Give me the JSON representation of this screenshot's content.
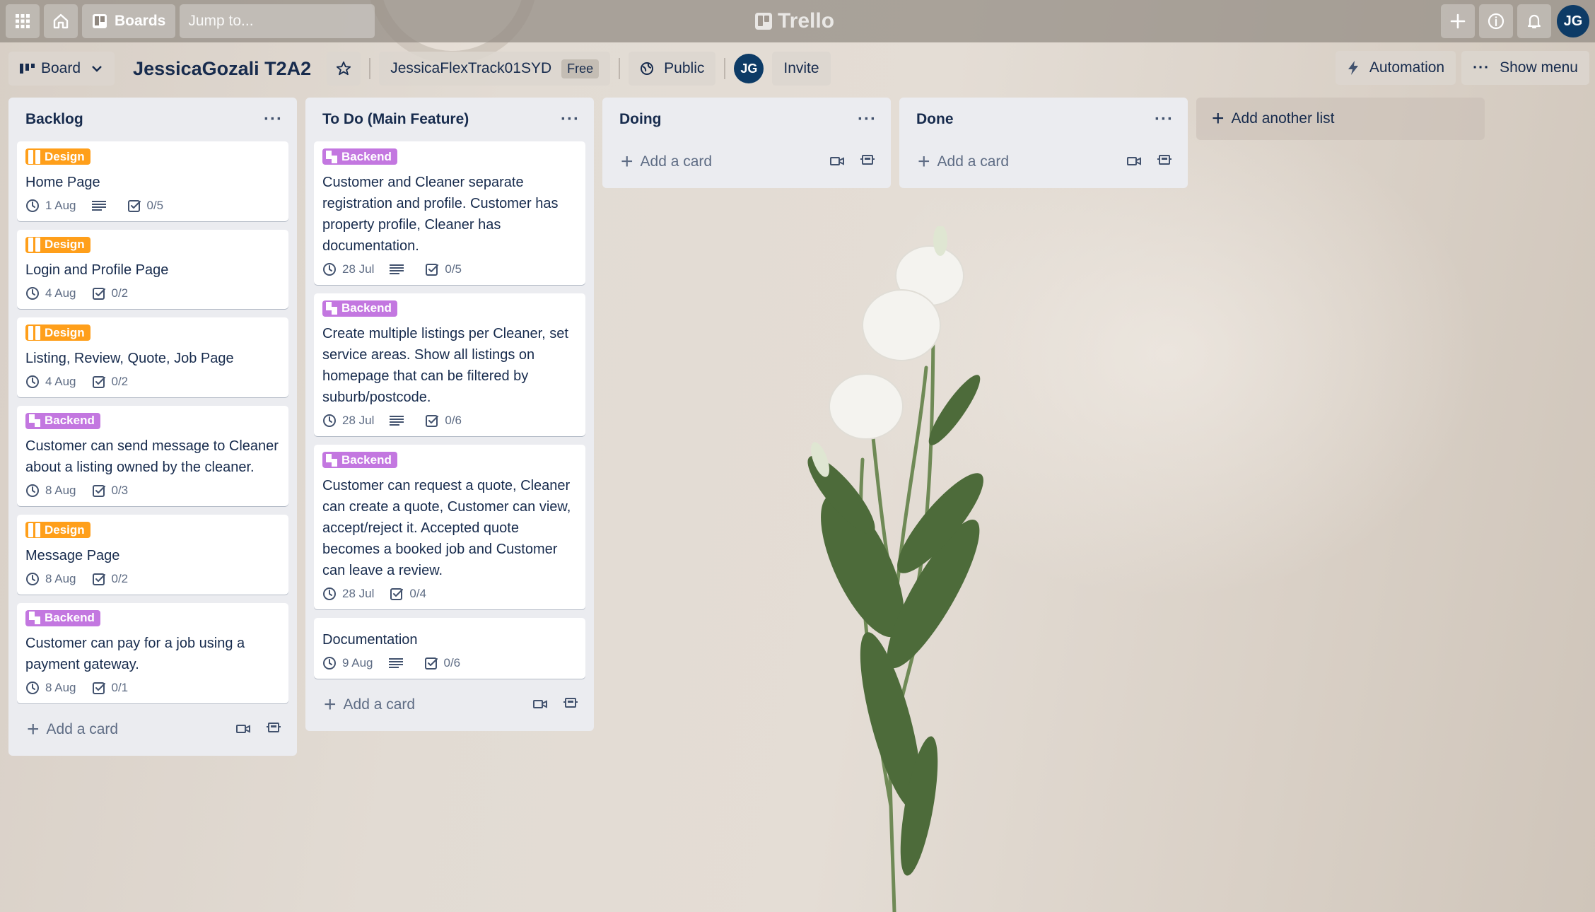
{
  "app": {
    "logo_text": "Trello",
    "boards_label": "Boards",
    "search_placeholder": "Jump to...",
    "user_initials": "JG"
  },
  "board": {
    "view_label": "Board",
    "title": "JessicaGozali T2A2",
    "workspace": "JessicaFlexTrack01SYD",
    "workspace_plan": "Free",
    "visibility": "Public",
    "invite_label": "Invite",
    "automation_label": "Automation",
    "show_menu_label": "Show menu"
  },
  "colors": {
    "design_label": "#ff9f1a",
    "backend_label": "#c377e0",
    "list_bg": "#ebecf0"
  },
  "lists": [
    {
      "title": "Backlog",
      "add_card_label": "Add a card",
      "cards": [
        {
          "label": "Design",
          "title": "Home Page",
          "due": "1 Aug",
          "has_description": true,
          "checklist": "0/5"
        },
        {
          "label": "Design",
          "title": "Login and Profile Page",
          "due": "4 Aug",
          "has_description": false,
          "checklist": "0/2"
        },
        {
          "label": "Design",
          "title": "Listing, Review, Quote, Job Page",
          "due": "4 Aug",
          "has_description": false,
          "checklist": "0/2"
        },
        {
          "label": "Backend",
          "title": "Customer can send message to Cleaner about a listing owned by the cleaner.",
          "due": "8 Aug",
          "has_description": false,
          "checklist": "0/3"
        },
        {
          "label": "Design",
          "title": "Message Page",
          "due": "8 Aug",
          "has_description": false,
          "checklist": "0/2"
        },
        {
          "label": "Backend",
          "title": "Customer can pay for a job using a payment gateway.",
          "due": "8 Aug",
          "has_description": false,
          "checklist": "0/1"
        }
      ]
    },
    {
      "title": "To Do (Main Feature)",
      "add_card_label": "Add a card",
      "cards": [
        {
          "label": "Backend",
          "title": "Customer and Cleaner separate registration and profile. Customer has property profile, Cleaner has documentation.",
          "due": "28 Jul",
          "has_description": true,
          "checklist": "0/5"
        },
        {
          "label": "Backend",
          "title": "Create multiple listings per Cleaner, set service areas. Show all listings on homepage that can be filtered by suburb/postcode.",
          "due": "28 Jul",
          "has_description": true,
          "checklist": "0/6"
        },
        {
          "label": "Backend",
          "title": "Customer can request a quote, Cleaner can create a quote, Customer can view, accept/reject it. Accepted quote becomes a booked job and Customer can leave a review.",
          "due": "28 Jul",
          "has_description": false,
          "checklist": "0/4"
        },
        {
          "label": "",
          "title": "Documentation",
          "due": "9 Aug",
          "has_description": true,
          "checklist": "0/6"
        }
      ]
    },
    {
      "title": "Doing",
      "add_card_label": "Add a card",
      "cards": []
    },
    {
      "title": "Done",
      "add_card_label": "Add a card",
      "cards": []
    }
  ],
  "add_list_label": "Add another list"
}
